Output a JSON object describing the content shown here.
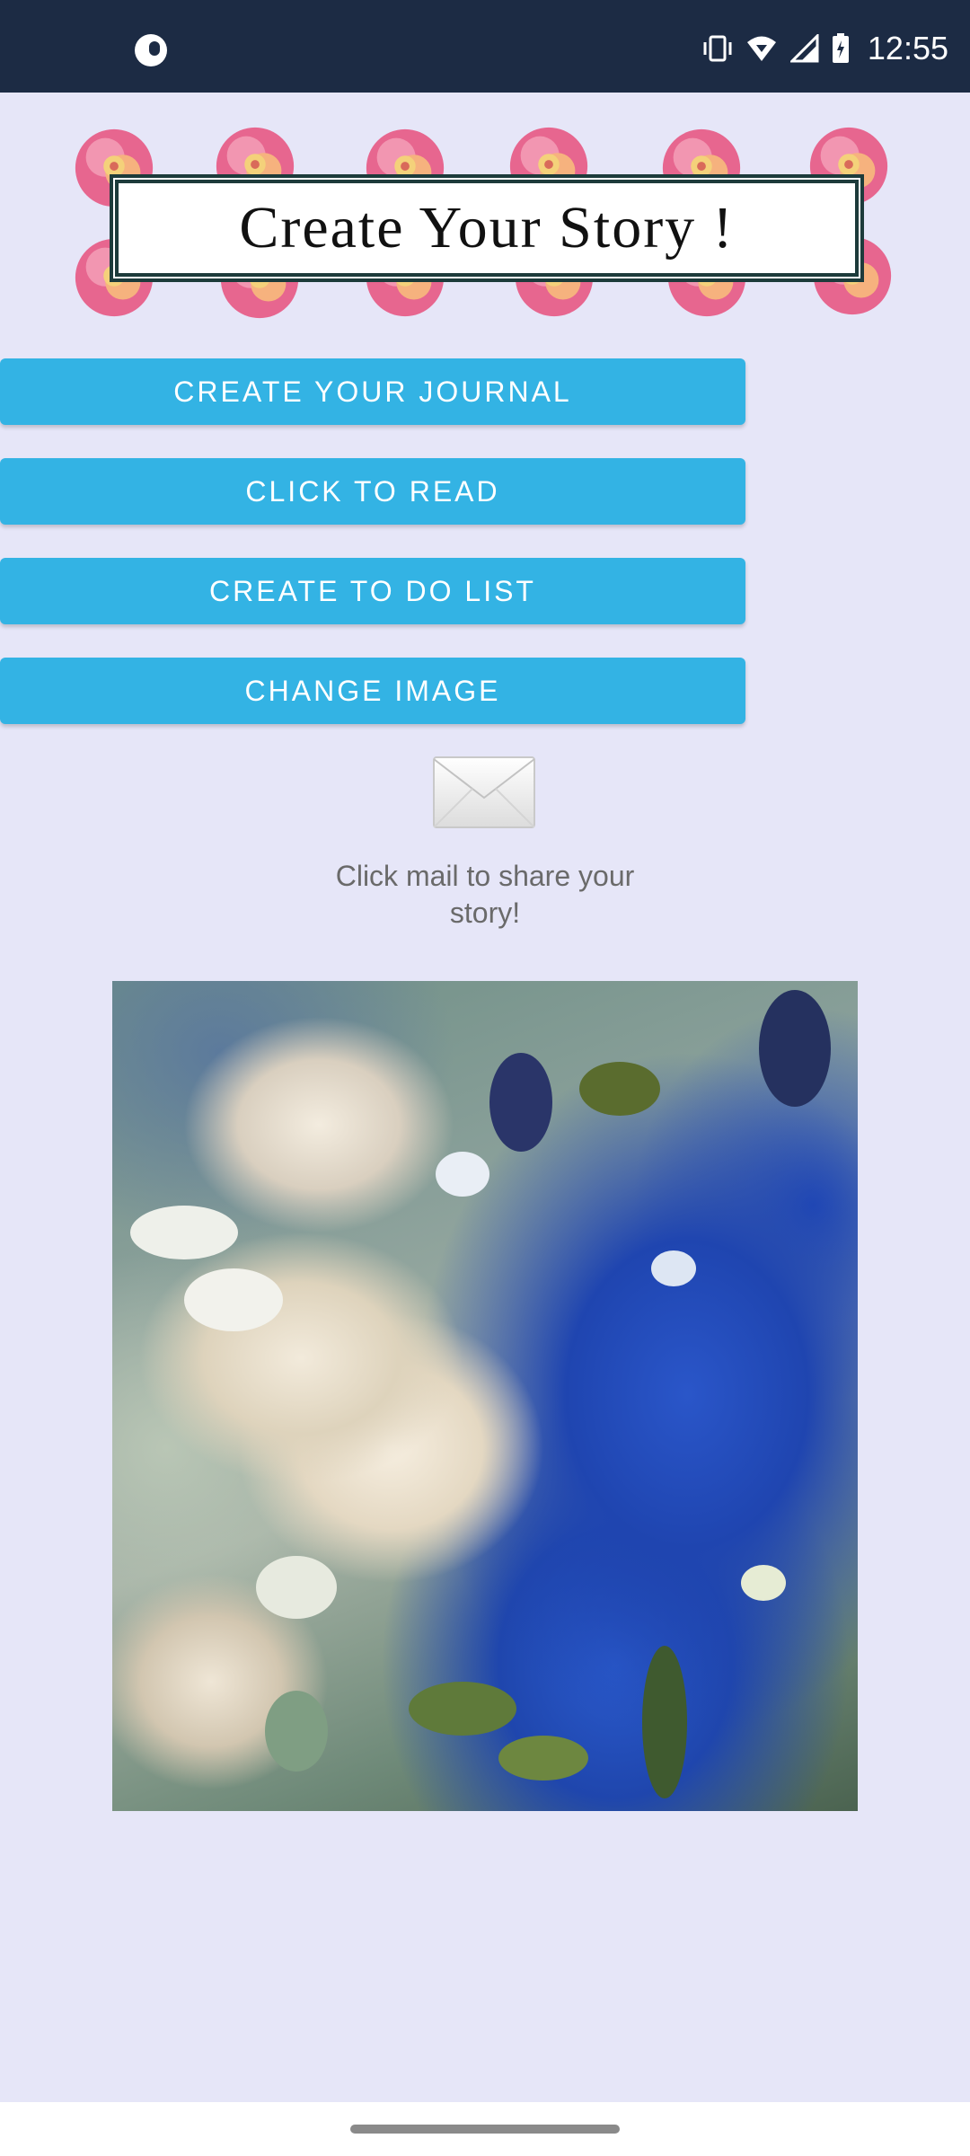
{
  "status_bar": {
    "time": "12:55",
    "icons": [
      "app-notification-icon",
      "vibrate-icon",
      "wifi-icon",
      "signal-icon",
      "battery-icon"
    ]
  },
  "header": {
    "title": "Create Your Story !"
  },
  "buttons": {
    "create_journal": "CREATE YOUR JOURNAL",
    "click_to_read": "CLICK TO READ",
    "create_todo": "CREATE TO DO LIST",
    "change_image": "CHANGE IMAGE"
  },
  "share": {
    "icon": "mail-envelope-icon",
    "text": "Click mail to share your story!"
  },
  "colors": {
    "status_bar": "#1c2b44",
    "background": "#e6e6f8",
    "button": "#33b3e4",
    "button_text": "#ffffff",
    "share_text": "#6a6a6a"
  }
}
